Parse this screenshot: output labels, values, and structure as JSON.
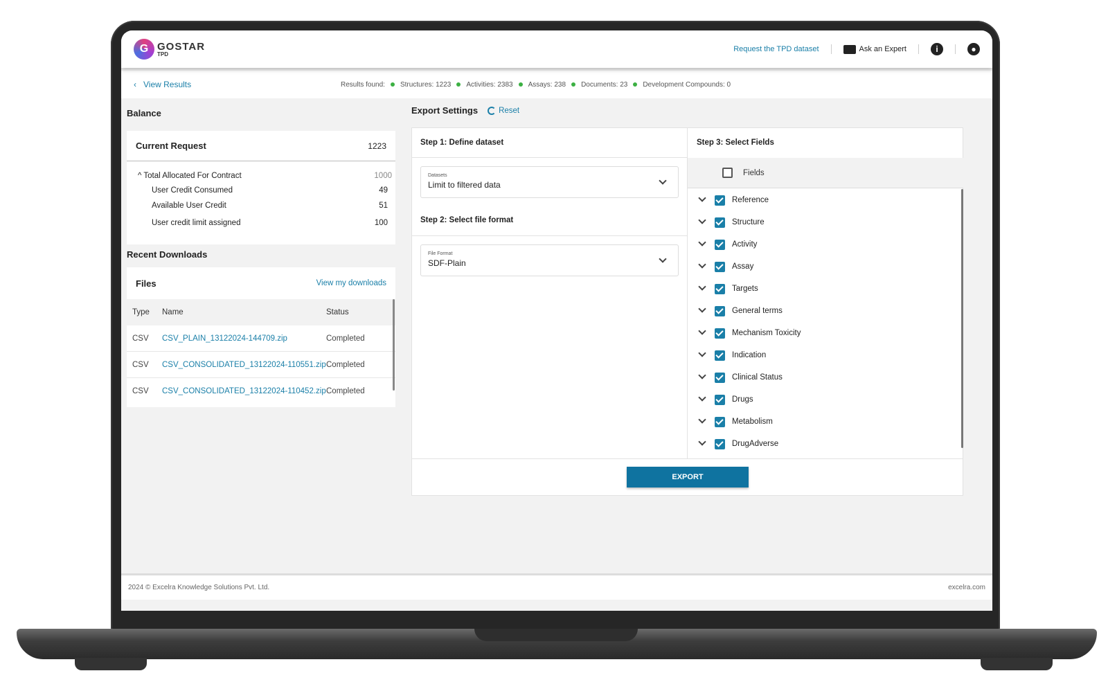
{
  "header": {
    "brand_name": "GOSTAR",
    "brand_sub": "TPD",
    "request_link": "Request the TPD dataset",
    "ask_expert": "Ask an Expert"
  },
  "subbar": {
    "back_label": "View Results",
    "results_label": "Results found:",
    "stats": [
      "Structures: 1223",
      "Activities: 2383",
      "Assays: 238",
      "Documents: 23",
      "Development Compounds: 0"
    ]
  },
  "balance": {
    "title": "Balance",
    "current_request_label": "Current Request",
    "current_request_value": "1223",
    "rows": [
      {
        "label": "Total Allocated For Contract",
        "value": "1000"
      },
      {
        "label": "User Credit Consumed",
        "value": "49"
      },
      {
        "label": "Available User Credit",
        "value": "51"
      },
      {
        "label": "User credit limit assigned",
        "value": "100"
      }
    ]
  },
  "downloads": {
    "title": "Recent Downloads",
    "files_label": "Files",
    "view_link": "View my downloads",
    "columns": [
      "Type",
      "Name",
      "Status"
    ],
    "rows": [
      {
        "type": "CSV",
        "name": "CSV_PLAIN_13122024-144709.zip",
        "status": "Completed"
      },
      {
        "type": "CSV",
        "name": "CSV_CONSOLIDATED_13122024-110551.zip",
        "status": "Completed"
      },
      {
        "type": "CSV",
        "name": "CSV_CONSOLIDATED_13122024-110452.zip",
        "status": "Completed"
      }
    ]
  },
  "export": {
    "title": "Export Settings",
    "reset_label": "Reset",
    "step1": "Step 1: Define dataset",
    "dataset_label": "Datasets",
    "dataset_value": "Limit to filtered data",
    "step2": "Step 2: Select file format",
    "format_label": "File Format",
    "format_value": "SDF-Plain",
    "step3": "Step 3: Select Fields",
    "fields_header": "Fields",
    "fields": [
      "Reference",
      "Structure",
      "Activity",
      "Assay",
      "Targets",
      "General terms",
      "Mechanism Toxicity",
      "Indication",
      "Clinical Status",
      "Drugs",
      "Metabolism",
      "DrugAdverse"
    ],
    "export_button": "EXPORT"
  },
  "footer": {
    "copyright": "2024 © Excelra Knowledge Solutions Pvt. Ltd.",
    "site": "excelra.com"
  }
}
